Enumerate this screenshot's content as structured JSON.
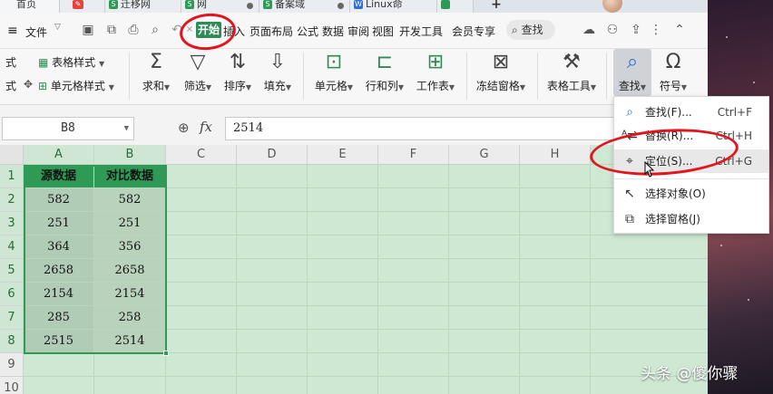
{
  "tabs": [
    {
      "label": "首页",
      "icon": ""
    },
    {
      "label": "",
      "icon": "wps-logo-icon"
    },
    {
      "label": "迁移网",
      "icon": "S"
    },
    {
      "label": "网",
      "icon": "S"
    },
    {
      "label": "备案域",
      "icon": "S"
    },
    {
      "label": "Linux命",
      "icon": "W"
    },
    {
      "label": "+",
      "icon": ""
    }
  ],
  "menu": {
    "file_label": "文件",
    "start_tab": "开始",
    "items": [
      "插入",
      "页面布局",
      "公式",
      "数据",
      "审阅",
      "视图",
      "开发工具",
      "会员专享"
    ],
    "search_label": "查找"
  },
  "ribbon": {
    "left_partial_1": "式",
    "left_partial_2": "式",
    "table_style": "表格样式",
    "cell_style": "单元格样式",
    "sum": "求和",
    "filter": "筛选",
    "sort": "排序",
    "fill": "填充",
    "cell": "单元格",
    "row_col": "行和列",
    "worksheet": "工作表",
    "freeze": "冻结窗格",
    "table_tools": "表格工具",
    "find": "查找",
    "symbol": "符号"
  },
  "formula_bar": {
    "cell_ref": "B8",
    "fx_label": "fx",
    "value": "2514"
  },
  "grid": {
    "columns": [
      "A",
      "B",
      "C",
      "D",
      "E",
      "F",
      "G",
      "H"
    ],
    "rows": [
      "1",
      "2",
      "3",
      "4",
      "5",
      "6",
      "7",
      "8",
      "9",
      "10"
    ],
    "headers": [
      "源数据",
      "对比数据"
    ],
    "data": [
      [
        "582",
        "582"
      ],
      [
        "251",
        "251"
      ],
      [
        "364",
        "356"
      ],
      [
        "2658",
        "2658"
      ],
      [
        "2154",
        "2154"
      ],
      [
        "285",
        "258"
      ],
      [
        "2515",
        "2514"
      ]
    ]
  },
  "dropdown": {
    "items": [
      {
        "label": "查找(F)...",
        "shortcut": "Ctrl+F",
        "icon": "search-icon"
      },
      {
        "label": "替换(R)...",
        "shortcut": "Ctrl+H",
        "icon": "replace-icon"
      },
      {
        "label": "定位(S)...",
        "shortcut": "Ctrl+G",
        "icon": "locate-icon"
      },
      {
        "label": "选择对象(O)",
        "shortcut": "",
        "icon": "select-object-icon"
      },
      {
        "label": "选择窗格(J)",
        "shortcut": "",
        "icon": "selection-pane-icon"
      }
    ]
  },
  "watermark": "头条 @傻你骤",
  "colors": {
    "accent": "#2e9a55",
    "annotation": "#e0161e"
  }
}
